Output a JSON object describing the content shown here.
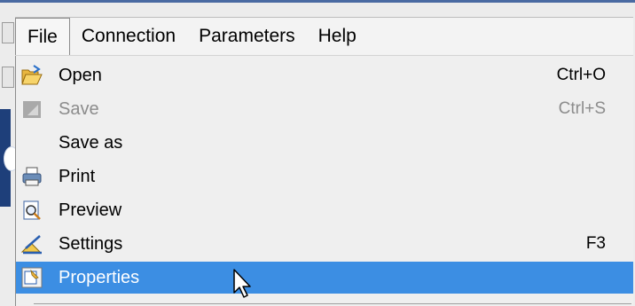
{
  "menubar": {
    "items": [
      {
        "label": "File"
      },
      {
        "label": "Connection"
      },
      {
        "label": "Parameters"
      },
      {
        "label": "Help"
      }
    ]
  },
  "file_menu": {
    "items": [
      {
        "label": "Open",
        "shortcut": "Ctrl+O",
        "icon": "folder-open-icon",
        "enabled": true
      },
      {
        "label": "Save",
        "shortcut": "Ctrl+S",
        "icon": "save-icon",
        "enabled": false
      },
      {
        "label": "Save as",
        "shortcut": "",
        "icon": "",
        "enabled": true
      },
      {
        "label": "Print",
        "shortcut": "",
        "icon": "printer-icon",
        "enabled": true
      },
      {
        "label": "Preview",
        "shortcut": "",
        "icon": "preview-icon",
        "enabled": true
      },
      {
        "label": "Settings",
        "shortcut": "F3",
        "icon": "settings-icon",
        "enabled": true
      },
      {
        "label": "Properties",
        "shortcut": "",
        "icon": "properties-icon",
        "enabled": true,
        "highlighted": true
      }
    ]
  },
  "colors": {
    "highlight": "#3c8ee3",
    "disabled_text": "#8c8c8c",
    "accent_blue": "#1e3f7a"
  }
}
